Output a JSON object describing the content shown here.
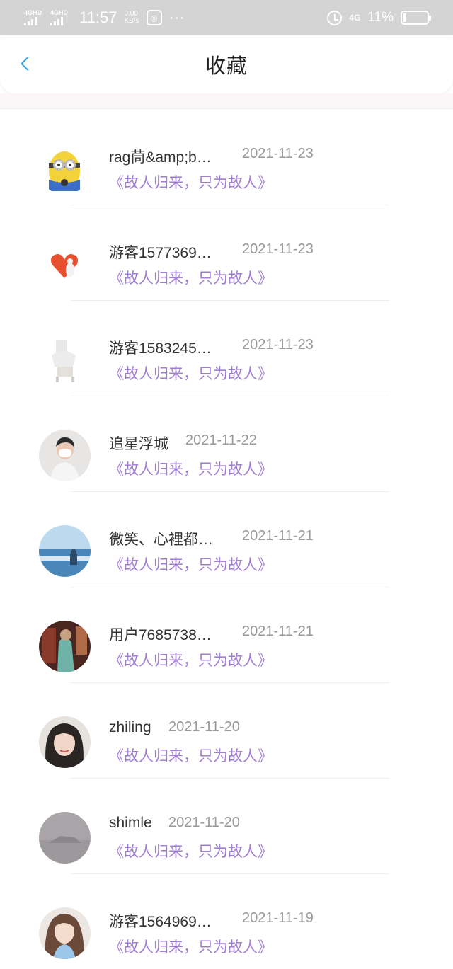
{
  "status_bar": {
    "sim1": "4GHD",
    "sim2": "4GHD",
    "time": "11:57",
    "speed_value": "0.00",
    "speed_unit": "KB/s",
    "dots": "···",
    "network": "4G",
    "battery": "11%"
  },
  "nav": {
    "title": "收藏",
    "back_icon": "chevron-left-icon",
    "accent": "#2a9ee8"
  },
  "items": [
    {
      "name": "rag茼&amp;b…",
      "date": "2021-11-23",
      "work": "《故人归来，只为故人》"
    },
    {
      "name": "游客1577369…",
      "date": "2021-11-23",
      "work": "《故人归来，只为故人》"
    },
    {
      "name": "游客1583245…",
      "date": "2021-11-23",
      "work": "《故人归来，只为故人》"
    },
    {
      "name": "追星浮城",
      "date": "2021-11-22",
      "work": "《故人归来，只为故人》"
    },
    {
      "name": "微笑、心裡都…",
      "date": "2021-11-21",
      "work": "《故人归来，只为故人》"
    },
    {
      "name": "用户7685738…",
      "date": "2021-11-21",
      "work": "《故人归来，只为故人》"
    },
    {
      "name": "zhiling",
      "date": "2021-11-20",
      "work": "《故人归来，只为故人》"
    },
    {
      "name": "shimle",
      "date": "2021-11-20",
      "work": "《故人归来，只为故人》"
    },
    {
      "name": "游客1564969…",
      "date": "2021-11-19",
      "work": "《故人归来，只为故人》"
    }
  ],
  "colors": {
    "link": "#a07ed3",
    "date": "#999999",
    "name": "#333333",
    "status_bar": "#d4d4d4"
  }
}
